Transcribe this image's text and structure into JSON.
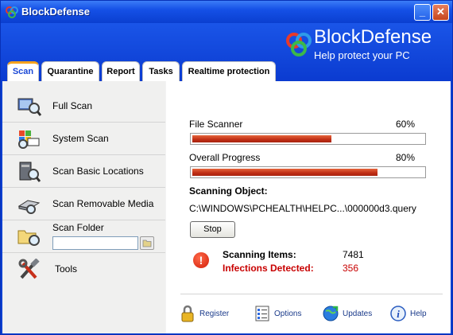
{
  "window": {
    "title": "BlockDefense",
    "minimize_label": "_",
    "close_label": "✕"
  },
  "header": {
    "brand_name": "BlockDefense",
    "tagline": "Help protect your PC"
  },
  "tabs": [
    {
      "label": "Scan",
      "active": true
    },
    {
      "label": "Quarantine",
      "active": false
    },
    {
      "label": "Report",
      "active": false
    },
    {
      "label": "Tasks",
      "active": false
    },
    {
      "label": "Realtime protection",
      "active": false
    }
  ],
  "sidebar": {
    "items": [
      {
        "label": "Full Scan",
        "icon": "full-scan-icon"
      },
      {
        "label": "System Scan",
        "icon": "system-scan-icon"
      },
      {
        "label": "Scan Basic Locations",
        "icon": "basic-locations-icon"
      },
      {
        "label": "Scan Removable Media",
        "icon": "removable-media-icon"
      },
      {
        "label": "Scan Folder",
        "icon": "scan-folder-icon"
      },
      {
        "label": "Tools",
        "icon": "tools-icon"
      }
    ],
    "folder_input_value": ""
  },
  "scan": {
    "file_scanner_label": "File Scanner",
    "file_scanner_percent": "60%",
    "file_scanner_value": 0.6,
    "overall_label": "Overall Progress",
    "overall_percent": "80%",
    "overall_value": 0.8,
    "scanning_object_label": "Scanning Object:",
    "scanning_object_path": "C:\\WINDOWS\\PCHEALTH\\HELPC...\\000000d3.query",
    "stop_label": "Stop",
    "items_label": "Scanning Items:",
    "items_value": "7481",
    "infections_label": "Infections Detected:",
    "infections_value": "356"
  },
  "footer": {
    "register": "Register",
    "options": "Options",
    "updates": "Updates",
    "help": "Help"
  },
  "colors": {
    "accent": "#0a3fd0",
    "danger": "#c80000",
    "progress": "#c3301a",
    "tab_highlight": "#f5a31e"
  }
}
